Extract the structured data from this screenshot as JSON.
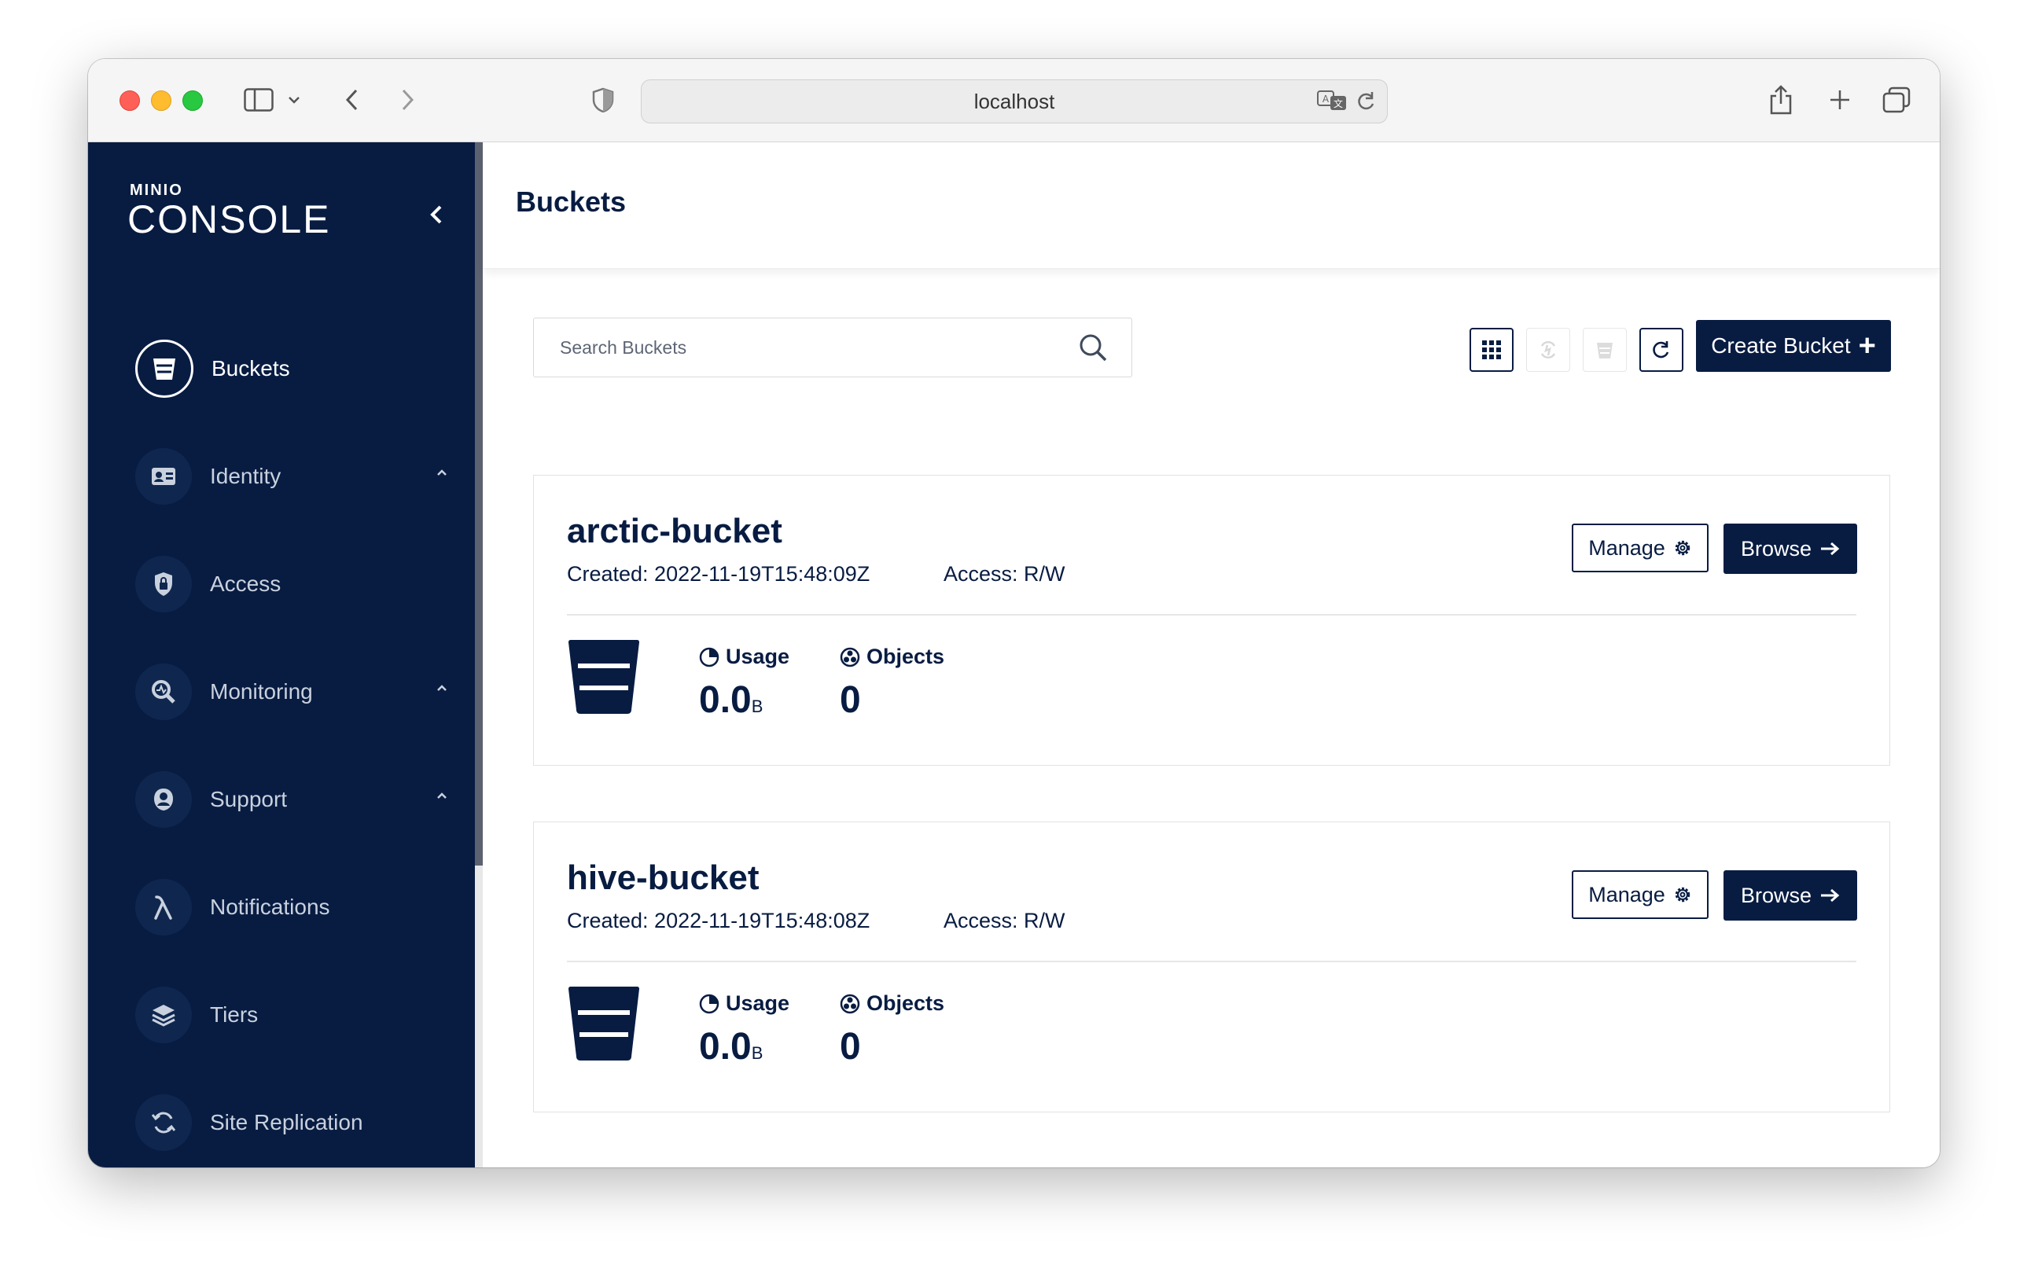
{
  "browser": {
    "url": "localhost"
  },
  "sidebar": {
    "logo_small": "MINIO",
    "logo_big": "CONSOLE",
    "items": [
      {
        "label": "Buckets",
        "icon": "bucket-icon",
        "active": true
      },
      {
        "label": "Identity",
        "icon": "id-card-icon",
        "expandable": true
      },
      {
        "label": "Access",
        "icon": "lock-icon"
      },
      {
        "label": "Monitoring",
        "icon": "monitoring-icon",
        "expandable": true
      },
      {
        "label": "Support",
        "icon": "support-icon",
        "expandable": true
      },
      {
        "label": "Notifications",
        "icon": "lambda-icon"
      },
      {
        "label": "Tiers",
        "icon": "layers-icon"
      },
      {
        "label": "Site Replication",
        "icon": "replication-icon"
      }
    ]
  },
  "header": {
    "title": "Buckets"
  },
  "toolbar": {
    "search_placeholder": "Search Buckets",
    "create_label": "Create Bucket"
  },
  "buckets": [
    {
      "name": "arctic-bucket",
      "created": "Created: 2022-11-19T15:48:09Z",
      "access": "Access: R/W",
      "manage_label": "Manage",
      "browse_label": "Browse",
      "usage_label": "Usage",
      "usage_value": "0.0",
      "usage_unit": "B",
      "objects_label": "Objects",
      "objects_value": "0"
    },
    {
      "name": "hive-bucket",
      "created": "Created: 2022-11-19T15:48:08Z",
      "access": "Access: R/W",
      "manage_label": "Manage",
      "browse_label": "Browse",
      "usage_label": "Usage",
      "usage_value": "0.0",
      "usage_unit": "B",
      "objects_label": "Objects",
      "objects_value": "0"
    }
  ],
  "colors": {
    "sidebar_bg": "#081c42",
    "primary": "#081c42",
    "traffic_red": "#fe5f57",
    "traffic_yellow": "#febc2e",
    "traffic_green": "#28c840"
  }
}
